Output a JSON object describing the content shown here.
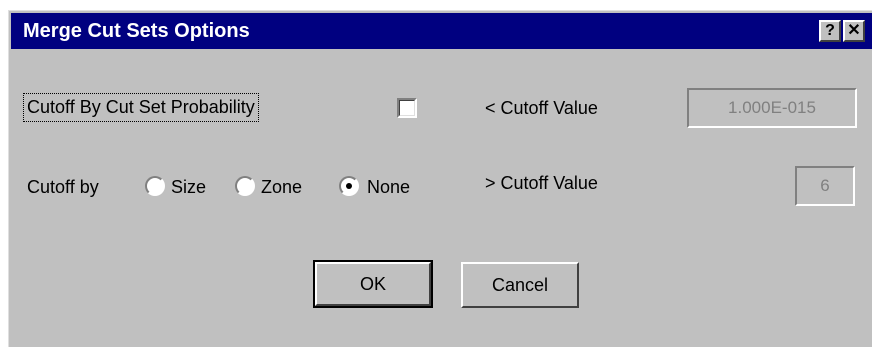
{
  "window": {
    "title": "Merge Cut Sets Options",
    "help_button": "?",
    "close_button": "✕"
  },
  "cutoff_probability": {
    "label": "Cutoff By Cut Set Probability",
    "checked": false,
    "value_label": "< Cutoff Value",
    "value": "1.000E-015"
  },
  "cutoff_by": {
    "label": "Cutoff by",
    "options": [
      {
        "label": "Size",
        "selected": false
      },
      {
        "label": "Zone",
        "selected": false
      },
      {
        "label": "None",
        "selected": true
      }
    ],
    "value_label": "> Cutoff Value",
    "value": "6"
  },
  "buttons": {
    "ok": "OK",
    "cancel": "Cancel"
  }
}
